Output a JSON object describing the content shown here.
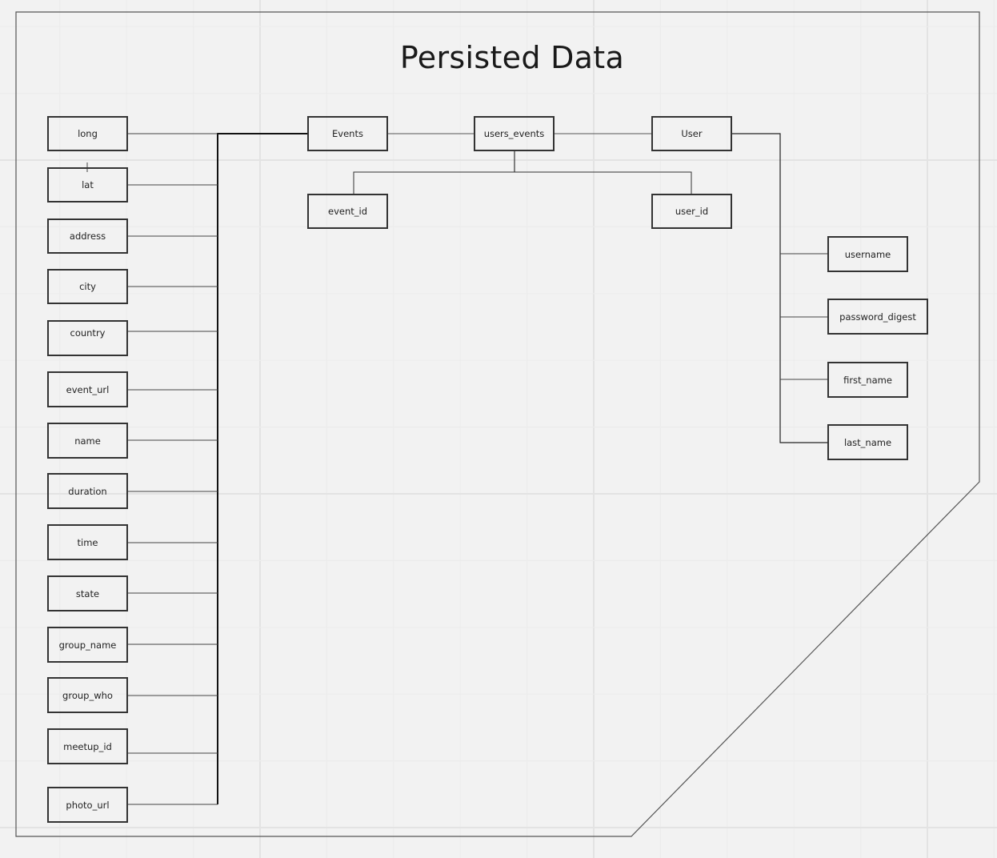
{
  "title": "Persisted Data",
  "colors": {
    "canvas": "#f2f2f2",
    "grid_minor": "#ececec",
    "grid_major": "#e3e3e3",
    "stroke": "#333333",
    "text": "#222222"
  },
  "entities": {
    "events": "Events",
    "users_events": "users_events",
    "user": "User"
  },
  "join_fields": [
    "event_id",
    "user_id"
  ],
  "event_fields": [
    "long",
    "lat",
    "address",
    "city",
    "country",
    "event_url",
    "name",
    "duration",
    "time",
    "state",
    "group_name",
    "group_who",
    "meetup_id",
    "photo_url"
  ],
  "user_fields": [
    "username",
    "password_digest",
    "first_name",
    "last_name"
  ]
}
